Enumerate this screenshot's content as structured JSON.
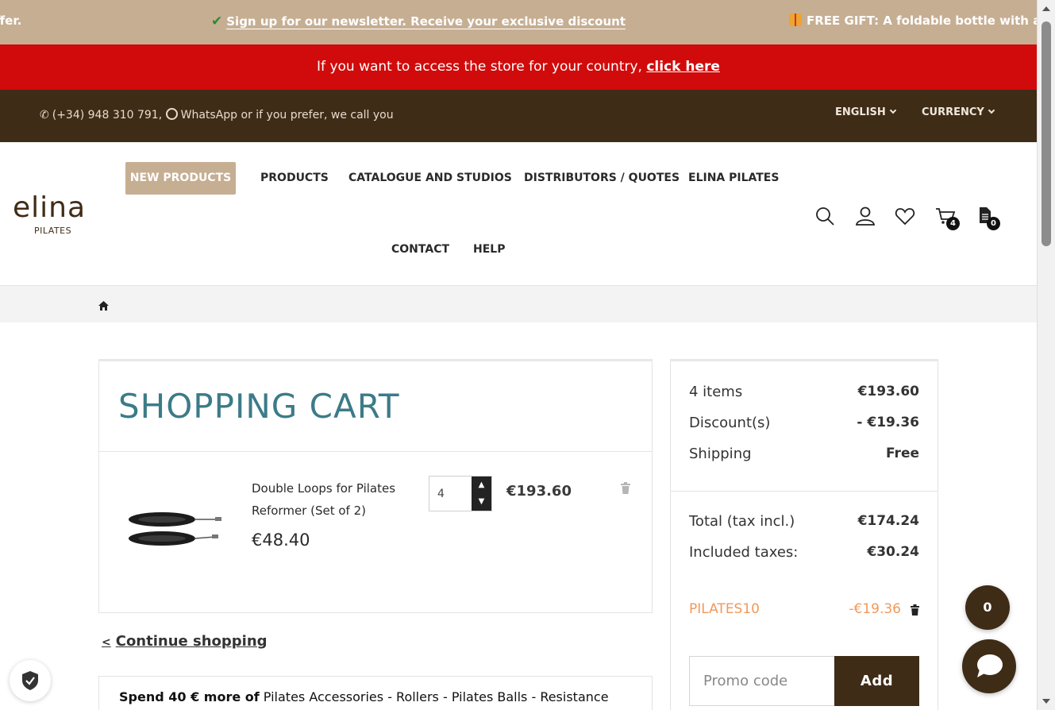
{
  "topbar": {
    "msg_left": "ffer.",
    "msg_center": "Sign up for our newsletter. Receive your exclusive discount",
    "msg_right": "FREE GIFT: A foldable bottle with any"
  },
  "country_bar": {
    "text": "If you want to access the store for your country, ",
    "link": "click here"
  },
  "contact_bar": {
    "phone": "(+34) 948 310 791,",
    "whatsapp": "WhatsApp or if you prefer, we call you",
    "language": "ENGLISH",
    "currency": "CURRENCY"
  },
  "logo": {
    "word": "elina",
    "sub": "PILATES"
  },
  "nav": {
    "new_products": "NEW PRODUCTS",
    "products": "PRODUCTS",
    "catalogue": "CATALOGUE AND STUDIOS",
    "distributors": "DISTRIBUTORS / QUOTES",
    "elina": "ELINA PILATES",
    "contact": "CONTACT",
    "help": "HELP"
  },
  "header_icons": {
    "cart_count": "4",
    "quote_count": "0"
  },
  "cart": {
    "title": "SHOPPING CART",
    "item": {
      "name": "Double Loops for Pilates Reformer (Set of 2)",
      "unit_price": "€48.40",
      "quantity": "4",
      "line_total": "€193.60"
    }
  },
  "continue_label": "Continue shopping",
  "spend_banner": {
    "bold": "Spend 40 € more of",
    "rest": " Pilates Accessories - Rollers - Pilates Balls - Resistance"
  },
  "summary": {
    "items_label": "4 items",
    "items_value": "€193.60",
    "discount_label": "Discount(s)",
    "discount_value": "- €19.36",
    "shipping_label": "Shipping",
    "shipping_value": "Free",
    "total_label": "Total (tax incl.)",
    "total_value": "€174.24",
    "taxes_label": "Included taxes:",
    "taxes_value": "€30.24",
    "promo_code": "PILATES10",
    "promo_value": "-€19.36",
    "promo_placeholder": "Promo code",
    "add_label": "Add"
  },
  "floating": {
    "count": "0"
  },
  "colors": {
    "beige": "#c6ae93",
    "red": "#d10b0b",
    "brown": "#3f2c17",
    "teal_title": "#3c7b88",
    "promo_orange": "#f0995b"
  }
}
